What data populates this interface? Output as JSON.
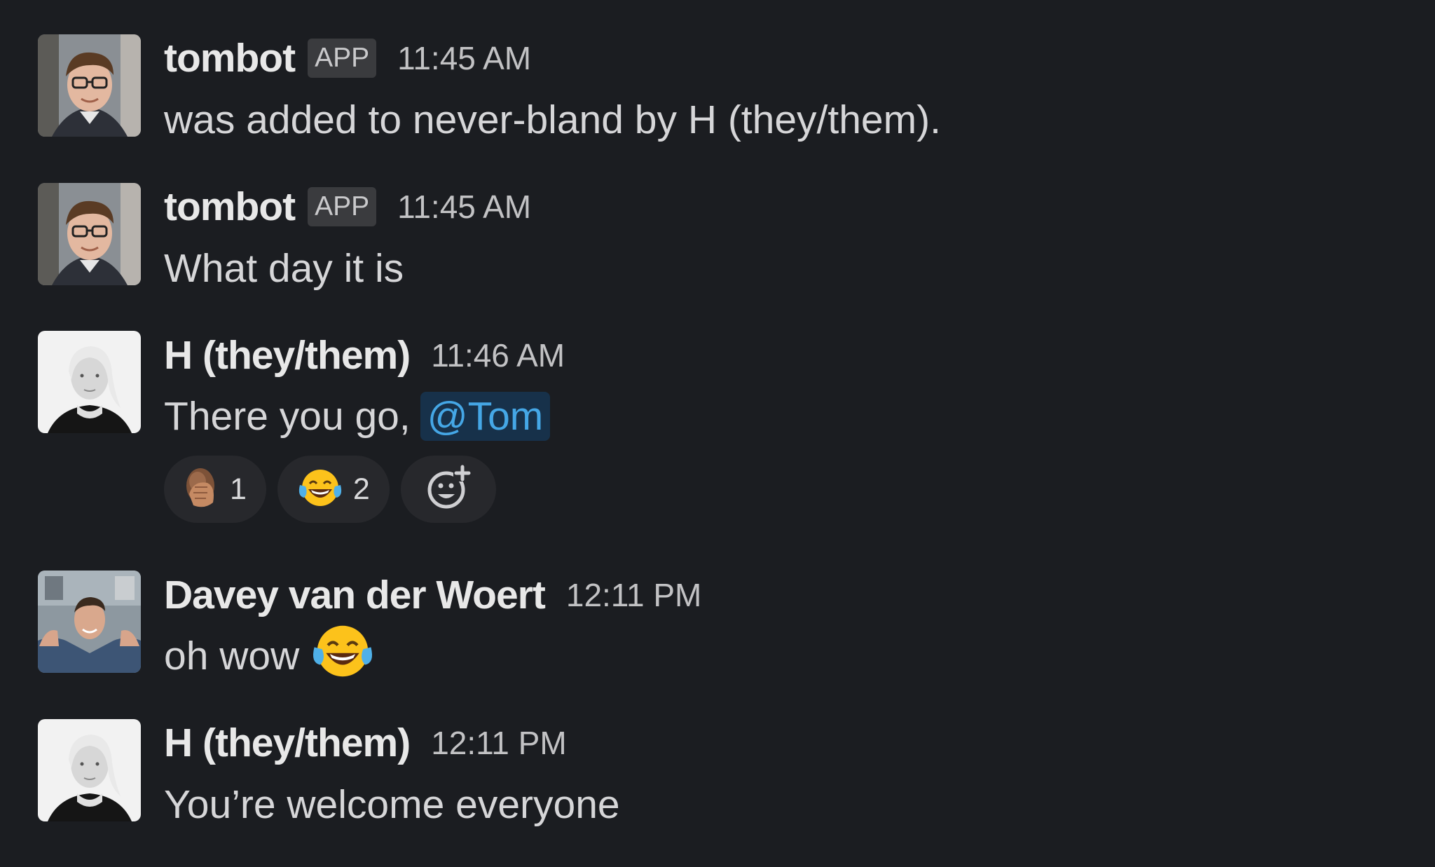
{
  "messages": [
    {
      "author": "tombot",
      "badge": "APP",
      "time": "11:45 AM",
      "text": "was added to never-bland by H (they/them)."
    },
    {
      "author": "tombot",
      "badge": "APP",
      "time": "11:45 AM",
      "text": "What day it is"
    },
    {
      "author": "H (they/them)",
      "time": "11:46 AM",
      "text": "There you go,",
      "mention": "@Tom",
      "reactions": [
        {
          "emoji": "facepalm-emoji",
          "count": "1"
        },
        {
          "emoji": "tears-of-joy-emoji",
          "count": "2"
        }
      ]
    },
    {
      "author": "Davey van der Woert",
      "time": "12:11 PM",
      "text": "oh wow",
      "inline_emoji": "tears-of-joy-emoji"
    },
    {
      "author": "H (they/them)",
      "time": "12:11 PM",
      "text": "You’re welcome everyone"
    }
  ],
  "colors": {
    "background": "#1b1d21",
    "mention_text": "#45a7e6",
    "mention_bg": "#17314a",
    "reaction_bg": "#27282c"
  }
}
